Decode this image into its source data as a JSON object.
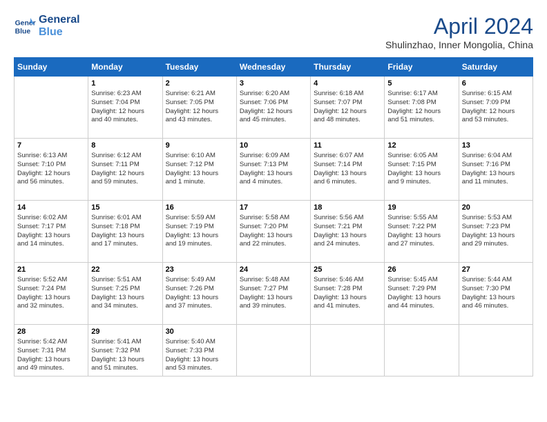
{
  "header": {
    "logo_line1": "General",
    "logo_line2": "Blue",
    "month_year": "April 2024",
    "location": "Shulinzhao, Inner Mongolia, China"
  },
  "days_of_week": [
    "Sunday",
    "Monday",
    "Tuesday",
    "Wednesday",
    "Thursday",
    "Friday",
    "Saturday"
  ],
  "weeks": [
    [
      {
        "day": "",
        "info": ""
      },
      {
        "day": "1",
        "info": "Sunrise: 6:23 AM\nSunset: 7:04 PM\nDaylight: 12 hours\nand 40 minutes."
      },
      {
        "day": "2",
        "info": "Sunrise: 6:21 AM\nSunset: 7:05 PM\nDaylight: 12 hours\nand 43 minutes."
      },
      {
        "day": "3",
        "info": "Sunrise: 6:20 AM\nSunset: 7:06 PM\nDaylight: 12 hours\nand 45 minutes."
      },
      {
        "day": "4",
        "info": "Sunrise: 6:18 AM\nSunset: 7:07 PM\nDaylight: 12 hours\nand 48 minutes."
      },
      {
        "day": "5",
        "info": "Sunrise: 6:17 AM\nSunset: 7:08 PM\nDaylight: 12 hours\nand 51 minutes."
      },
      {
        "day": "6",
        "info": "Sunrise: 6:15 AM\nSunset: 7:09 PM\nDaylight: 12 hours\nand 53 minutes."
      }
    ],
    [
      {
        "day": "7",
        "info": "Sunrise: 6:13 AM\nSunset: 7:10 PM\nDaylight: 12 hours\nand 56 minutes."
      },
      {
        "day": "8",
        "info": "Sunrise: 6:12 AM\nSunset: 7:11 PM\nDaylight: 12 hours\nand 59 minutes."
      },
      {
        "day": "9",
        "info": "Sunrise: 6:10 AM\nSunset: 7:12 PM\nDaylight: 13 hours\nand 1 minute."
      },
      {
        "day": "10",
        "info": "Sunrise: 6:09 AM\nSunset: 7:13 PM\nDaylight: 13 hours\nand 4 minutes."
      },
      {
        "day": "11",
        "info": "Sunrise: 6:07 AM\nSunset: 7:14 PM\nDaylight: 13 hours\nand 6 minutes."
      },
      {
        "day": "12",
        "info": "Sunrise: 6:05 AM\nSunset: 7:15 PM\nDaylight: 13 hours\nand 9 minutes."
      },
      {
        "day": "13",
        "info": "Sunrise: 6:04 AM\nSunset: 7:16 PM\nDaylight: 13 hours\nand 11 minutes."
      }
    ],
    [
      {
        "day": "14",
        "info": "Sunrise: 6:02 AM\nSunset: 7:17 PM\nDaylight: 13 hours\nand 14 minutes."
      },
      {
        "day": "15",
        "info": "Sunrise: 6:01 AM\nSunset: 7:18 PM\nDaylight: 13 hours\nand 17 minutes."
      },
      {
        "day": "16",
        "info": "Sunrise: 5:59 AM\nSunset: 7:19 PM\nDaylight: 13 hours\nand 19 minutes."
      },
      {
        "day": "17",
        "info": "Sunrise: 5:58 AM\nSunset: 7:20 PM\nDaylight: 13 hours\nand 22 minutes."
      },
      {
        "day": "18",
        "info": "Sunrise: 5:56 AM\nSunset: 7:21 PM\nDaylight: 13 hours\nand 24 minutes."
      },
      {
        "day": "19",
        "info": "Sunrise: 5:55 AM\nSunset: 7:22 PM\nDaylight: 13 hours\nand 27 minutes."
      },
      {
        "day": "20",
        "info": "Sunrise: 5:53 AM\nSunset: 7:23 PM\nDaylight: 13 hours\nand 29 minutes."
      }
    ],
    [
      {
        "day": "21",
        "info": "Sunrise: 5:52 AM\nSunset: 7:24 PM\nDaylight: 13 hours\nand 32 minutes."
      },
      {
        "day": "22",
        "info": "Sunrise: 5:51 AM\nSunset: 7:25 PM\nDaylight: 13 hours\nand 34 minutes."
      },
      {
        "day": "23",
        "info": "Sunrise: 5:49 AM\nSunset: 7:26 PM\nDaylight: 13 hours\nand 37 minutes."
      },
      {
        "day": "24",
        "info": "Sunrise: 5:48 AM\nSunset: 7:27 PM\nDaylight: 13 hours\nand 39 minutes."
      },
      {
        "day": "25",
        "info": "Sunrise: 5:46 AM\nSunset: 7:28 PM\nDaylight: 13 hours\nand 41 minutes."
      },
      {
        "day": "26",
        "info": "Sunrise: 5:45 AM\nSunset: 7:29 PM\nDaylight: 13 hours\nand 44 minutes."
      },
      {
        "day": "27",
        "info": "Sunrise: 5:44 AM\nSunset: 7:30 PM\nDaylight: 13 hours\nand 46 minutes."
      }
    ],
    [
      {
        "day": "28",
        "info": "Sunrise: 5:42 AM\nSunset: 7:31 PM\nDaylight: 13 hours\nand 49 minutes."
      },
      {
        "day": "29",
        "info": "Sunrise: 5:41 AM\nSunset: 7:32 PM\nDaylight: 13 hours\nand 51 minutes."
      },
      {
        "day": "30",
        "info": "Sunrise: 5:40 AM\nSunset: 7:33 PM\nDaylight: 13 hours\nand 53 minutes."
      },
      {
        "day": "",
        "info": ""
      },
      {
        "day": "",
        "info": ""
      },
      {
        "day": "",
        "info": ""
      },
      {
        "day": "",
        "info": ""
      }
    ]
  ]
}
